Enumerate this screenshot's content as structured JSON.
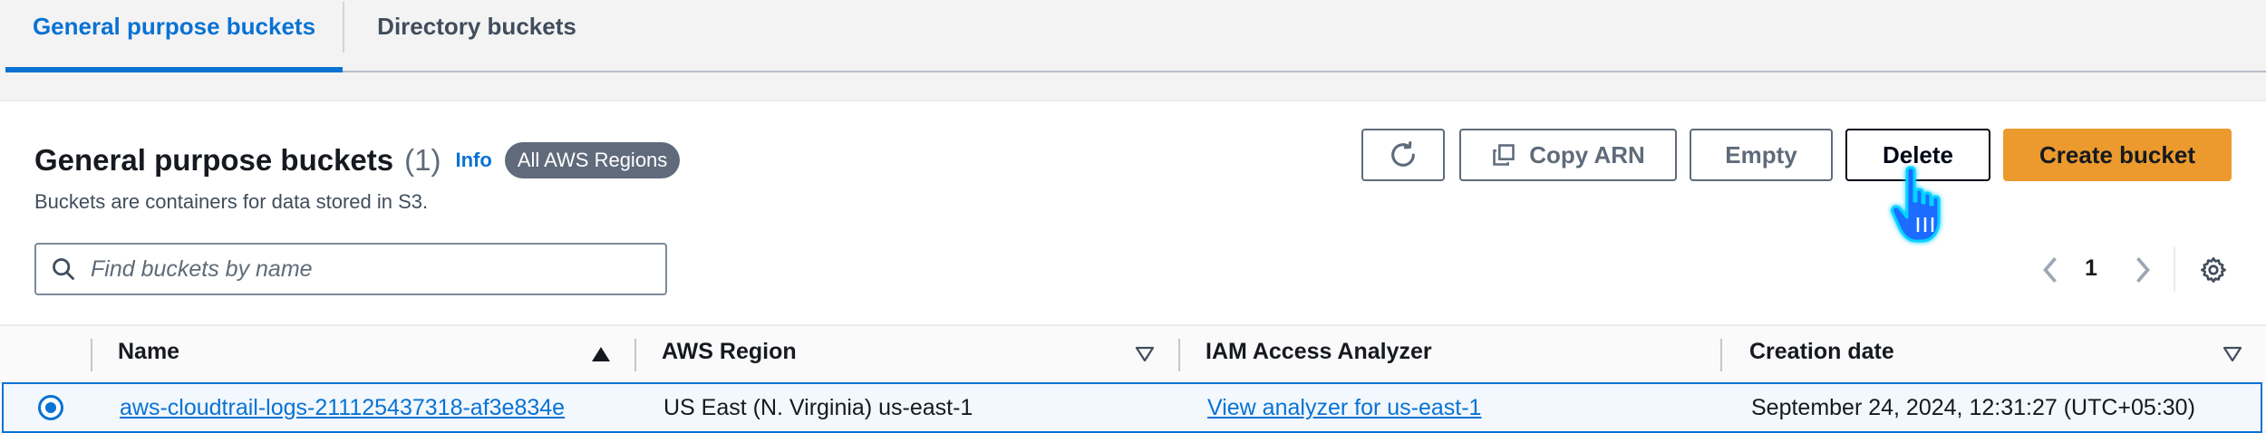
{
  "tabs": [
    {
      "label": "General purpose buckets",
      "active": true
    },
    {
      "label": "Directory buckets",
      "active": false
    }
  ],
  "panel": {
    "title": "General purpose buckets",
    "count": "(1)",
    "info": "Info",
    "region_badge": "All AWS Regions",
    "description": "Buckets are containers for data stored in S3."
  },
  "toolbar": {
    "refresh_icon": "refresh-icon",
    "copy_arn_label": "Copy ARN",
    "copy_icon": "copy-icon",
    "empty_label": "Empty",
    "delete_label": "Delete",
    "create_label": "Create bucket"
  },
  "search": {
    "placeholder": "Find buckets by name",
    "value": ""
  },
  "pagination": {
    "current_page": "1"
  },
  "table": {
    "columns": [
      {
        "label": "Name",
        "sort": "ascending"
      },
      {
        "label": "AWS Region",
        "sort": "none"
      },
      {
        "label": "IAM Access Analyzer",
        "sort": "none"
      },
      {
        "label": "Creation date",
        "sort": "none"
      }
    ],
    "rows": [
      {
        "selected": true,
        "name": "aws-cloudtrail-logs-211125437318-af3e834e",
        "region": "US East (N. Virginia) us-east-1",
        "analyzer": "View analyzer for us-east-1",
        "created": "September 24, 2024, 12:31:27 (UTC+05:30)"
      }
    ]
  },
  "colors": {
    "primary": "#0972d3",
    "create_button": "#ec9a2e",
    "badge": "#5f6b7a",
    "text": "#16191f"
  }
}
